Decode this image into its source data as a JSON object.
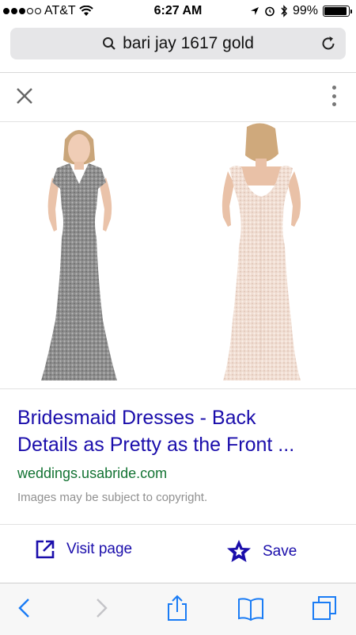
{
  "status": {
    "carrier": "AT&T",
    "time": "6:27 AM",
    "battery": "99%"
  },
  "search": {
    "query": "bari jay 1617 gold"
  },
  "result": {
    "title_line1": "Bridesmaid Dresses - Back",
    "title_line2": "Details as Pretty as the Front ...",
    "domain": "weddings.usabride.com",
    "copyright": "Images may be subject to copyright."
  },
  "actions": {
    "visit": "Visit page",
    "save": "Save"
  },
  "colors": {
    "link": "#1a0dab",
    "domain": "#137333",
    "ios_blue": "#1a7cf5",
    "dress_front": "#8e8e8e",
    "dress_back": "#f2dfd5"
  },
  "icons": {
    "search": "search-icon",
    "reload": "reload-icon",
    "close": "close-icon",
    "more": "more-vert-icon",
    "visit": "open-in-new-icon",
    "save": "star-bookmark-icon",
    "back": "chevron-left-icon",
    "forward": "chevron-right-icon",
    "share": "share-icon",
    "bookmarks": "book-icon",
    "tabs": "tabs-icon"
  }
}
